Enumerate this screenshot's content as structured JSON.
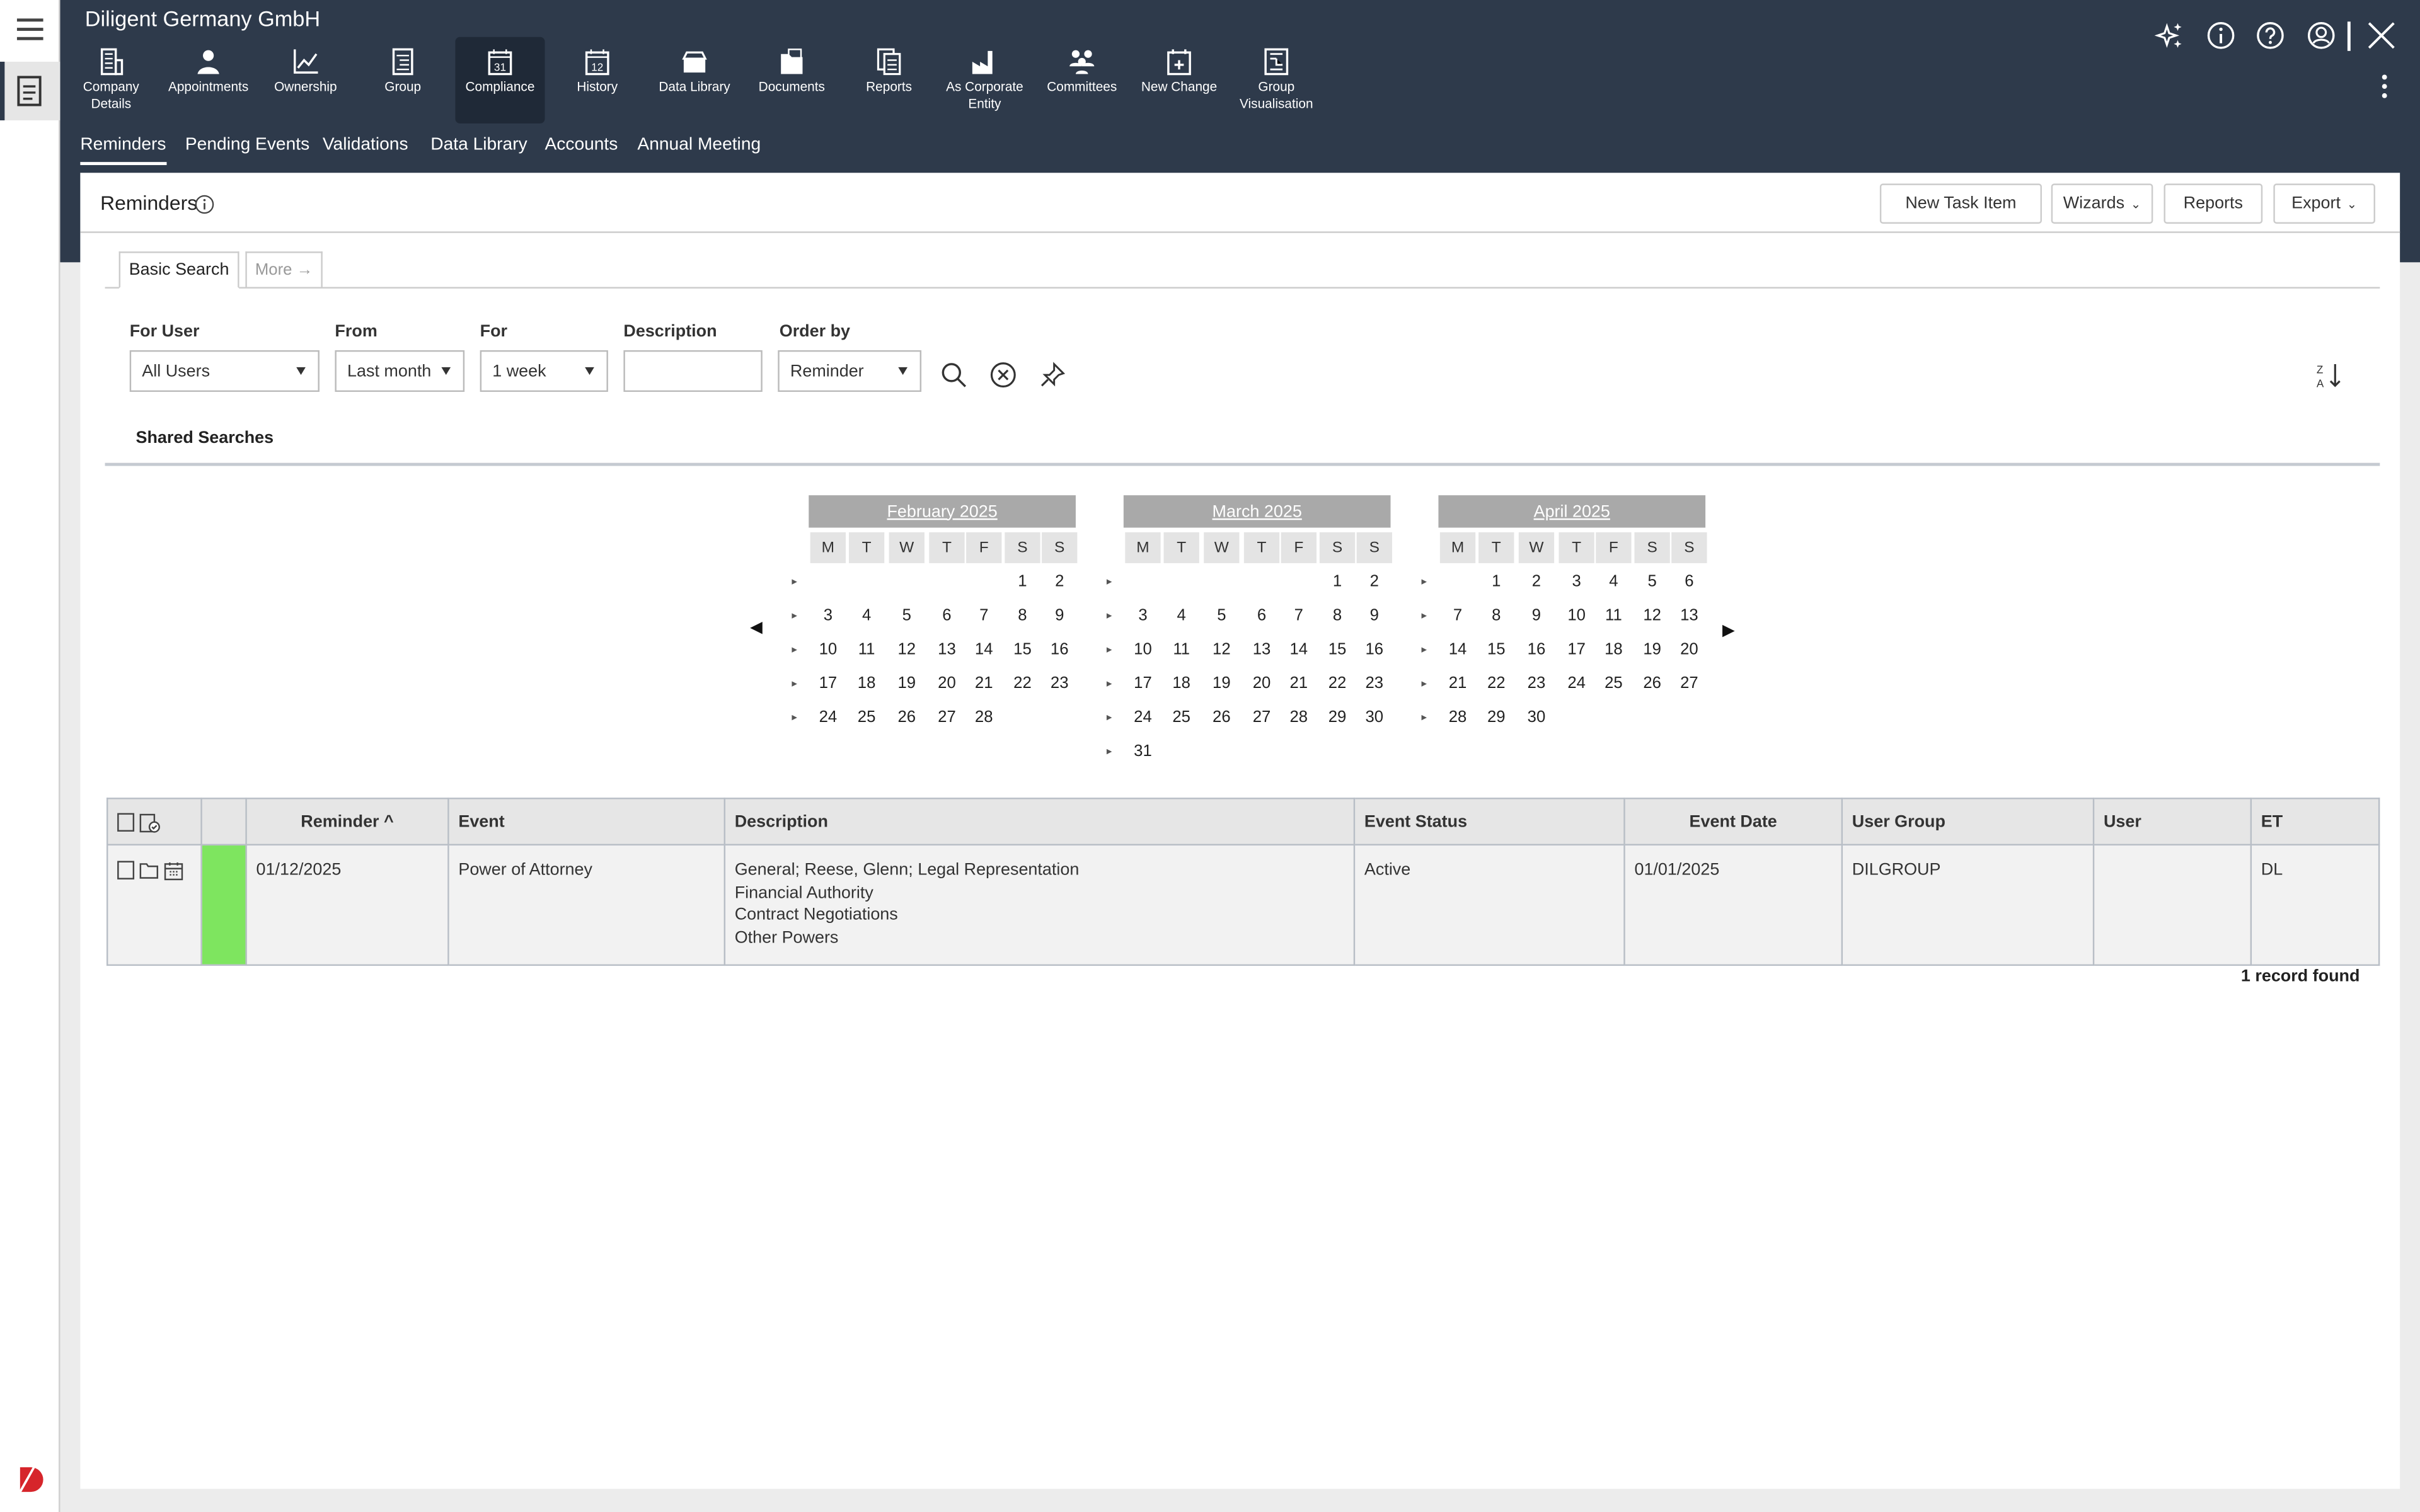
{
  "app": {
    "company": "Diligent Germany GmbH"
  },
  "nav": [
    {
      "label": "Company Details",
      "icon": "building-icon"
    },
    {
      "label": "Appointments",
      "icon": "person-icon"
    },
    {
      "label": "Ownership",
      "icon": "line-chart-icon"
    },
    {
      "label": "Group",
      "icon": "hierarchy-icon"
    },
    {
      "label": "Compliance",
      "icon": "calendar-31-icon",
      "selected": true
    },
    {
      "label": "History",
      "icon": "calendar-12-icon"
    },
    {
      "label": "Data Library",
      "icon": "drawer-icon"
    },
    {
      "label": "Documents",
      "icon": "folder-docs-icon"
    },
    {
      "label": "Reports",
      "icon": "report-pages-icon"
    },
    {
      "label": "As Corporate Entity",
      "icon": "factory-icon"
    },
    {
      "label": "Committees",
      "icon": "people-group-icon"
    },
    {
      "label": "New Change",
      "icon": "calendar-add-icon"
    },
    {
      "label": "Group Visualisation",
      "icon": "diagram-icon"
    }
  ],
  "subtabs": [
    "Reminders",
    "Pending Events",
    "Validations",
    "Data Library",
    "Accounts",
    "Annual Meeting"
  ],
  "page": {
    "title": "Reminders",
    "buttons": {
      "new_task": "New Task Item",
      "wizards": "Wizards",
      "reports": "Reports",
      "export": "Export"
    }
  },
  "search": {
    "tabs": {
      "basic": "Basic Search",
      "more": "More →"
    },
    "fields": {
      "for_user": {
        "label": "For User",
        "value": "All Users"
      },
      "from": {
        "label": "From",
        "value": "Last month"
      },
      "for": {
        "label": "For",
        "value": "1 week"
      },
      "description": {
        "label": "Description",
        "value": ""
      },
      "order_by": {
        "label": "Order by",
        "value": "Reminder"
      }
    },
    "shared": "Shared Searches"
  },
  "calendar": {
    "weekdays": [
      "M",
      "T",
      "W",
      "T",
      "F",
      "S",
      "S"
    ],
    "months": [
      {
        "title": "February 2025",
        "weeks": [
          [
            "",
            "",
            "",
            "",
            "",
            "1",
            "2"
          ],
          [
            "3",
            "4",
            "5",
            "6",
            "7",
            "8",
            "9"
          ],
          [
            "10",
            "11",
            "12",
            "13",
            "14",
            "15",
            "16"
          ],
          [
            "17",
            "18",
            "19",
            "20",
            "21",
            "22",
            "23"
          ],
          [
            "24",
            "25",
            "26",
            "27",
            "28",
            "",
            ""
          ]
        ]
      },
      {
        "title": "March 2025",
        "weeks": [
          [
            "",
            "",
            "",
            "",
            "",
            "1",
            "2"
          ],
          [
            "3",
            "4",
            "5",
            "6",
            "7",
            "8",
            "9"
          ],
          [
            "10",
            "11",
            "12",
            "13",
            "14",
            "15",
            "16"
          ],
          [
            "17",
            "18",
            "19",
            "20",
            "21",
            "22",
            "23"
          ],
          [
            "24",
            "25",
            "26",
            "27",
            "28",
            "29",
            "30"
          ],
          [
            "31",
            "",
            "",
            "",
            "",
            "",
            ""
          ]
        ]
      },
      {
        "title": "April 2025",
        "weeks": [
          [
            "",
            "1",
            "2",
            "3",
            "4",
            "5",
            "6"
          ],
          [
            "7",
            "8",
            "9",
            "10",
            "11",
            "12",
            "13"
          ],
          [
            "14",
            "15",
            "16",
            "17",
            "18",
            "19",
            "20"
          ],
          [
            "21",
            "22",
            "23",
            "24",
            "25",
            "26",
            "27"
          ],
          [
            "28",
            "29",
            "30",
            "",
            "",
            "",
            ""
          ]
        ]
      }
    ]
  },
  "table": {
    "headers": {
      "reminder": "Reminder ^",
      "event": "Event",
      "description": "Description",
      "status": "Event Status",
      "date": "Event Date",
      "group": "User Group",
      "user": "User",
      "et": "ET"
    },
    "rows": [
      {
        "reminder": "01/12/2025",
        "event": "Power of Attorney",
        "description": [
          "General; Reese, Glenn; Legal Representation",
          "Financial Authority",
          "Contract Negotiations",
          "Other Powers"
        ],
        "status": "Active",
        "date": "01/01/2025",
        "group": "DILGROUP",
        "user": "",
        "et": "DL",
        "color": "#7ee55f"
      }
    ],
    "footer": "1 record found"
  }
}
